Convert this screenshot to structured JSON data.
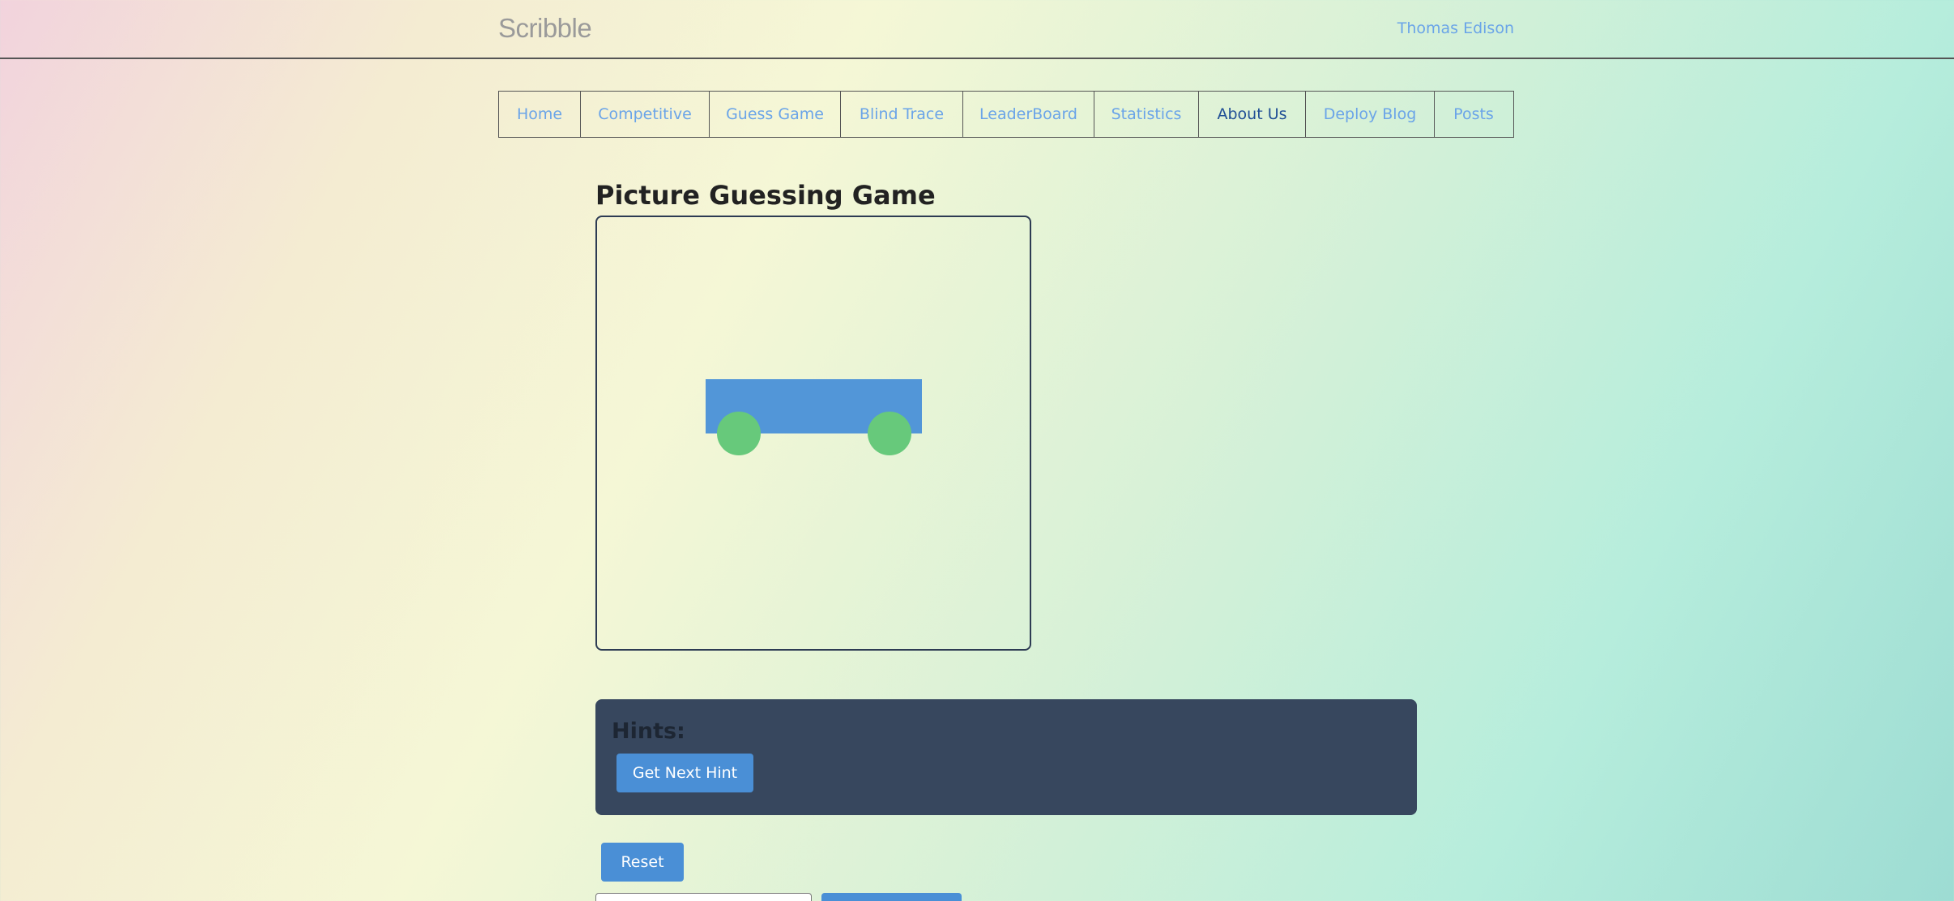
{
  "header": {
    "brand": "Scribble",
    "user": "Thomas Edison"
  },
  "nav": {
    "items": [
      {
        "label": "Home",
        "active": false
      },
      {
        "label": "Competitive",
        "active": false
      },
      {
        "label": "Guess Game",
        "active": false
      },
      {
        "label": "Blind Trace",
        "active": false
      },
      {
        "label": "LeaderBoard",
        "active": false
      },
      {
        "label": "Statistics",
        "active": false
      },
      {
        "label": "About Us",
        "active": true
      },
      {
        "label": "Deploy Blog",
        "active": false
      },
      {
        "label": "Posts",
        "active": false
      }
    ]
  },
  "main": {
    "title": "Picture Guessing Game",
    "drawing": {
      "shapes": [
        "car-body",
        "front-wheel",
        "rear-wheel"
      ],
      "colors": {
        "body": "#5296d8",
        "wheels": "#67c97b"
      }
    }
  },
  "hints": {
    "title": "Hints:",
    "button_label": "Get Next Hint"
  },
  "controls": {
    "reset_label": "Reset",
    "guess_placeholder": "",
    "submit_label": ""
  },
  "colors": {
    "accent": "#4a8fd6",
    "link": "#6aa4e8",
    "active_link": "#1f4e95",
    "panel": "#37475e"
  }
}
